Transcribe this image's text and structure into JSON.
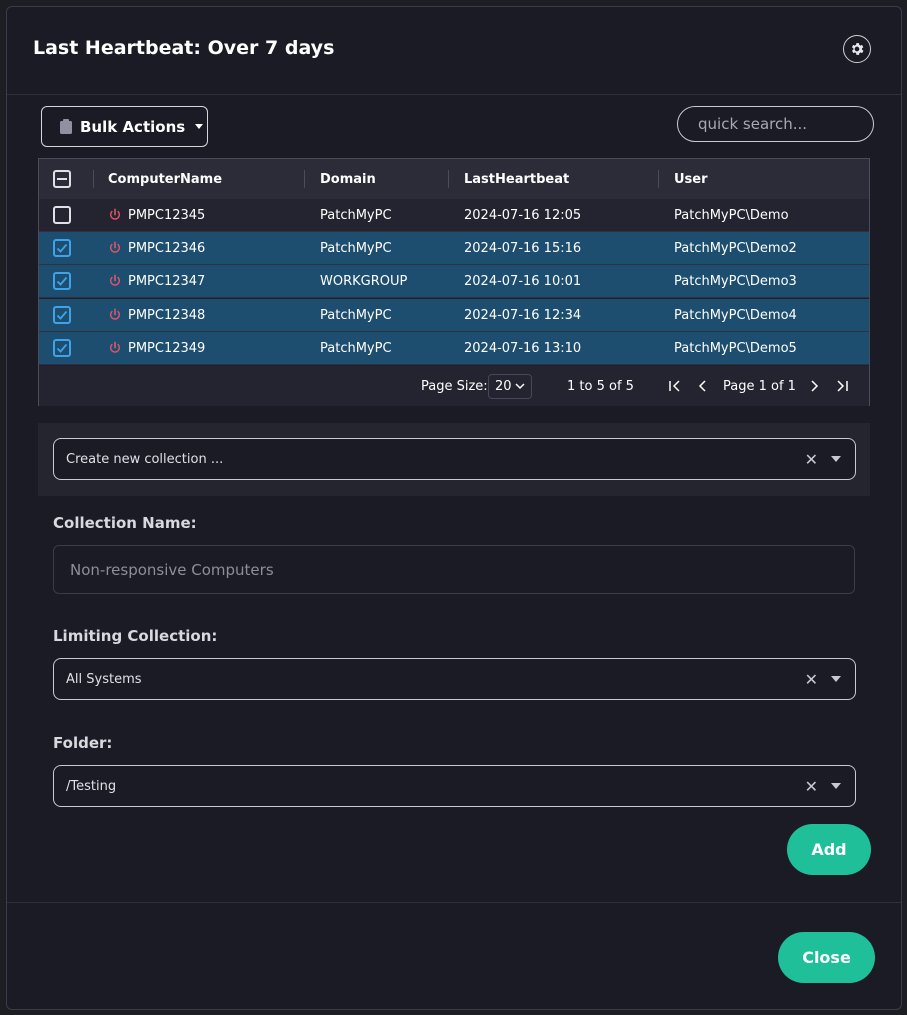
{
  "dialog": {
    "title": "Last Heartbeat: Over 7 days"
  },
  "toolbar": {
    "bulk_actions_label": "Bulk Actions",
    "search_placeholder": "quick search..."
  },
  "grid": {
    "columns": [
      "ComputerName",
      "Domain",
      "LastHeartbeat",
      "User"
    ],
    "rows": [
      {
        "computer": "PMPC12345",
        "domain": "PatchMyPC",
        "heartbeat": "2024-07-16 12:05",
        "user": "PatchMyPC\\Demo",
        "selected": false
      },
      {
        "computer": "PMPC12346",
        "domain": "PatchMyPC",
        "heartbeat": "2024-07-16 15:16",
        "user": "PatchMyPC\\Demo2",
        "selected": true
      },
      {
        "computer": "PMPC12347",
        "domain": "WORKGROUP",
        "heartbeat": "2024-07-16 10:01",
        "user": "PatchMyPC\\Demo3",
        "selected": true
      },
      {
        "computer": "PMPC12348",
        "domain": "PatchMyPC",
        "heartbeat": "2024-07-16 12:34",
        "user": "PatchMyPC\\Demo4",
        "selected": true
      },
      {
        "computer": "PMPC12349",
        "domain": "PatchMyPC",
        "heartbeat": "2024-07-16 13:10",
        "user": "PatchMyPC\\Demo5",
        "selected": true
      }
    ]
  },
  "pager": {
    "page_size_label": "Page Size:",
    "page_size_value": "20",
    "range_text": "1 to 5 of 5",
    "page_text": "Page 1 of 1"
  },
  "form": {
    "create_collection_value": "Create new collection ...",
    "collection_name_label": "Collection Name:",
    "collection_name_placeholder": "Non-responsive Computers",
    "limiting_collection_label": "Limiting Collection:",
    "limiting_collection_value": "All Systems",
    "folder_label": "Folder:",
    "folder_value": "/Testing",
    "add_label": "Add"
  },
  "footer": {
    "close_label": "Close"
  },
  "colors": {
    "accent": "#1fbf9a",
    "selected_row": "#1d4e6f",
    "checkbox": "#3ea3e8",
    "power_icon": "#e0566a"
  }
}
